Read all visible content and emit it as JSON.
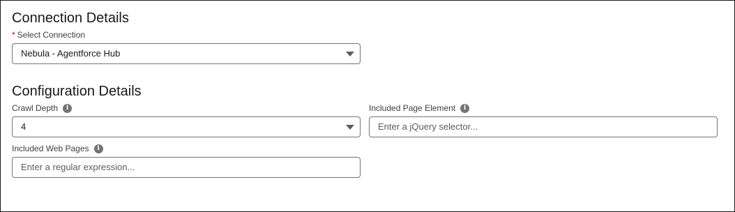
{
  "connection_section": {
    "title": "Connection Details",
    "select_connection": {
      "required_mark": "*",
      "label": "Select Connection",
      "value": "Nebula - Agentforce Hub"
    }
  },
  "configuration_section": {
    "title": "Configuration Details",
    "crawl_depth": {
      "label": "Crawl Depth",
      "info_icon": "info-icon",
      "value": "4"
    },
    "included_page_element": {
      "label": "Included Page Element",
      "info_icon": "info-icon",
      "placeholder": "Enter a jQuery selector..."
    },
    "included_web_pages": {
      "label": "Included Web Pages",
      "info_icon": "info-icon",
      "placeholder": "Enter a regular expression..."
    }
  },
  "colors": {
    "required": "#ba0517",
    "border": "#747474",
    "text": "#181818"
  }
}
